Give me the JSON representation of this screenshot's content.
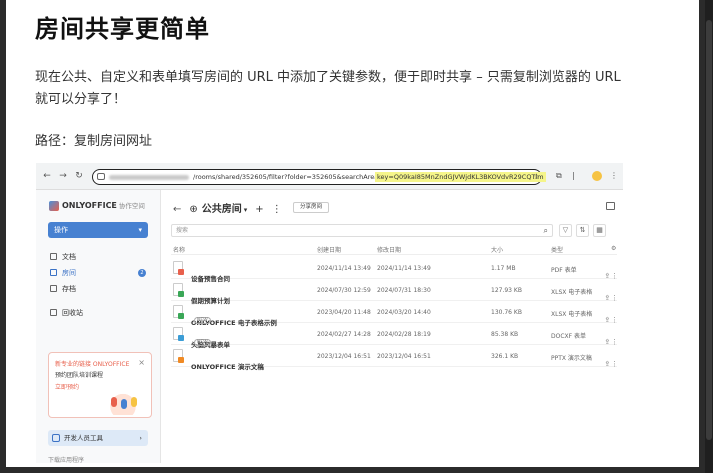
{
  "article": {
    "title": "房间共享更简单",
    "paragraph": "现在公共、自定义和表单填写房间的 URL 中添加了关键参数，便于即时共享 – 只需复制浏览器的 URL 就可以分享了！",
    "path_label": "路径：复制房间网址"
  },
  "browser": {
    "url_path": "/rooms/shared/352605/filter?folder=352605&searchArea=3&",
    "url_key": "key=Q09kaI85MnZndGJVWjdKL3BKOVdvR29CQTlm"
  },
  "app": {
    "brand": "ONLYOFFICE",
    "brand_sub": "协作空间",
    "operation_button": "操作",
    "sidebar_items": [
      {
        "label": "文档",
        "icon": "document-icon"
      },
      {
        "label": "房间",
        "icon": "room-icon",
        "badge": "2",
        "active": true
      },
      {
        "label": "存档",
        "icon": "archive-icon"
      },
      {
        "label": "回收站",
        "icon": "trash-icon"
      }
    ],
    "promo": {
      "line1": "新专业的链接 ONLYOFFICE",
      "line2": "预约团队培训课程",
      "link": "立即预约"
    },
    "dev_tools": "开发人员工具",
    "download_apps": "下载应用程序",
    "breadcrumb_back": "←",
    "room_title": "公共房间",
    "share_button": "分享房间",
    "search_placeholder": "搜索",
    "columns": {
      "name": "名称",
      "created": "创建日期",
      "modified": "修改日期",
      "size": "大小",
      "type": "类型"
    },
    "files": [
      {
        "name": "设备预售合同",
        "created": "2024/11/14 13:49",
        "modified": "2024/11/14 13:49",
        "size": "1.17 MB",
        "type": "PDF 表单",
        "color": "#e8604c"
      },
      {
        "name": "假期预算计划",
        "created": "2024/07/30 12:59",
        "modified": "2024/07/31 18:30",
        "size": "127.93 KB",
        "type": "XLSX 电子表格",
        "color": "#3aa757"
      },
      {
        "name": "ONLYOFFICE 电子表格示例",
        "created": "2023/04/20 11:48",
        "modified": "2024/03/20 14:40",
        "size": "130.76 KB",
        "type": "XLSX 电子表格",
        "color": "#3aa757",
        "tag": "NEW"
      },
      {
        "name": "头脑风暴表单",
        "created": "2024/02/27 14:28",
        "modified": "2024/02/28 18:19",
        "size": "85.38 KB",
        "type": "DOCXF 表单",
        "color": "#3b9dd6",
        "tag": "NEW"
      },
      {
        "name": "ONLYOFFICE 演示文稿",
        "created": "2023/12/04 16:51",
        "modified": "2023/12/04 16:51",
        "size": "326.1 KB",
        "type": "PPTX 演示文稿",
        "color": "#f08a24"
      }
    ]
  }
}
